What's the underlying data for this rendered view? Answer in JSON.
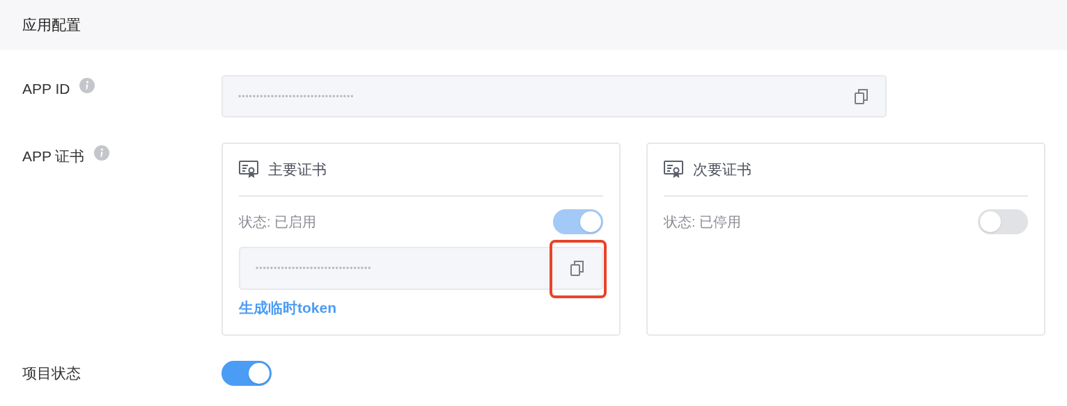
{
  "section_title": "应用配置",
  "app_id": {
    "label": "APP ID",
    "value": "••••••••••••••••••••••••••••••••"
  },
  "certificates": {
    "label": "APP 证书",
    "cards": [
      {
        "title": "主要证书",
        "status": "状态: 已启用",
        "on": true,
        "disabled": true,
        "value": "••••••••••••••••••••••••••••••••",
        "copy_highlighted": true,
        "link": "生成临时token"
      },
      {
        "title": "次要证书",
        "status": "状态: 已停用",
        "on": false,
        "disabled": false
      }
    ]
  },
  "project_status": {
    "label": "项目状态",
    "on": true,
    "disabled": false
  }
}
